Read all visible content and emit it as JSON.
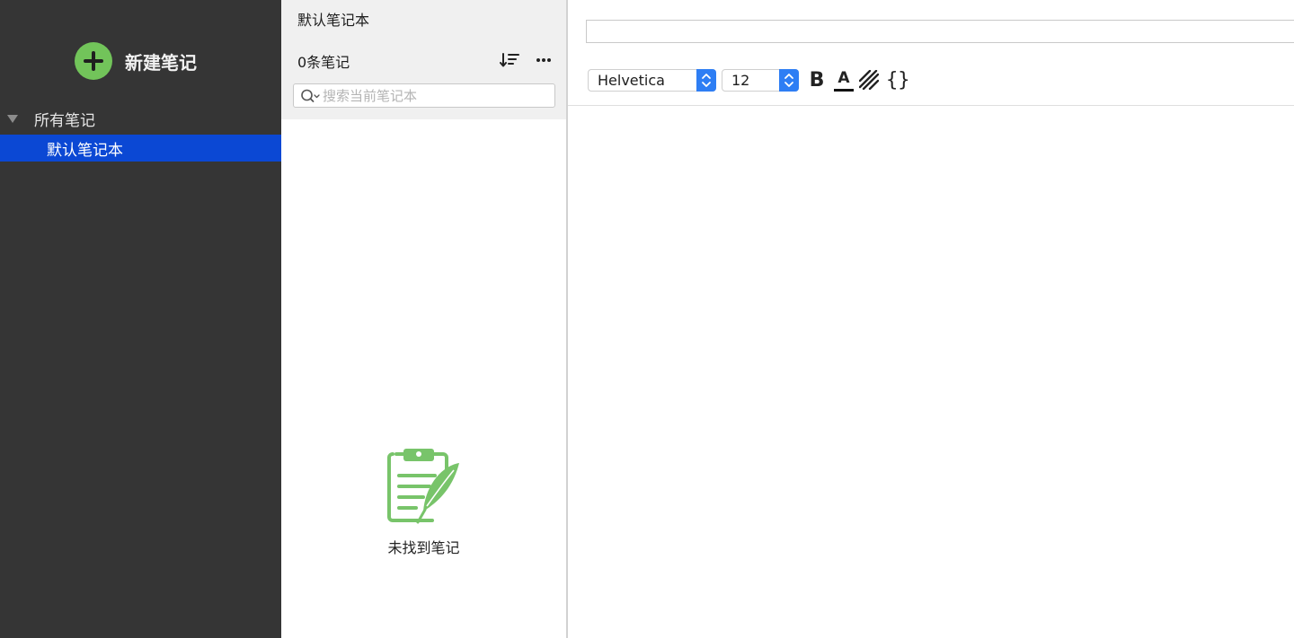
{
  "sidebar": {
    "new_note_label": "新建笔记",
    "all_notes_label": "所有笔记",
    "selected_notebook_label": "默认笔记本",
    "colors": {
      "background": "#353535",
      "selected": "#0b48d4",
      "accent": "#72c45a"
    }
  },
  "notelist": {
    "notebook_title": "默认笔记本",
    "count_label": "0条笔记",
    "search_placeholder": "搜索当前笔记本",
    "search_value": "",
    "empty_label": "未找到笔记",
    "icons": [
      "sort-icon",
      "more-icon",
      "search-icon",
      "empty-notes-icon"
    ]
  },
  "editor": {
    "title_value": "",
    "font_family": "Helvetica",
    "font_size": "12",
    "bold_label": "B",
    "color_label": "A",
    "code_label": "{}",
    "stepper_color": "#2e7ef4"
  }
}
